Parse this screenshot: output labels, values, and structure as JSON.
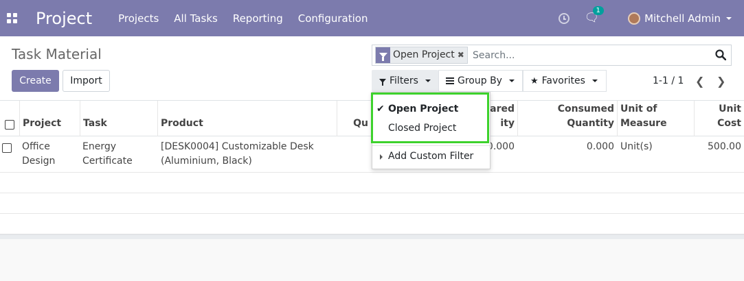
{
  "navbar": {
    "app_title": "Project",
    "menu": [
      "Projects",
      "All Tasks",
      "Reporting",
      "Configuration"
    ],
    "chat_badge": "1",
    "user_name": "Mitchell Admin",
    "colors": {
      "brand": "#7c7bad",
      "badge": "#00a09d",
      "highlight": "#3dd22c"
    }
  },
  "control_panel": {
    "page_title": "Task Material",
    "create_label": "Create",
    "import_label": "Import",
    "search": {
      "facet_label": "Open Project",
      "facet_remove": "✖",
      "placeholder": "Search..."
    },
    "filters_label": "Filters",
    "groupby_label": "Group By",
    "favorites_label": "Favorites",
    "pager": {
      "value": "1-1 / 1",
      "prev": "❮",
      "next": "❯"
    }
  },
  "filters_dropdown": {
    "items": [
      {
        "label": "Open Project",
        "checked": true,
        "check": "✔"
      },
      {
        "label": "Closed Project",
        "checked": false
      }
    ],
    "custom_filter_label": "Add Custom Filter"
  },
  "table": {
    "headers": {
      "project": "Project",
      "task": "Task",
      "product": "Product",
      "quantity_partial": "Qu",
      "prepared_line1": "ared",
      "prepared_line2": "ity",
      "consumed_line1": "Consumed",
      "consumed_line2": "Quantity",
      "uom_line1": "Unit of",
      "uom_line2": "Measure",
      "unit_cost_line1": "Unit",
      "unit_cost_line2": "Cost"
    },
    "rows": [
      {
        "project_line1": "Office",
        "project_line2": "Design",
        "task_line1": "Energy",
        "task_line2": "Certificate",
        "product_line1": "[DESK0004] Customizable Desk",
        "product_line2": "(Aluminium, Black)",
        "prepared_partial": "0.000",
        "consumed": "0.000",
        "uom": "Unit(s)",
        "unit_cost": "500.00"
      }
    ]
  }
}
